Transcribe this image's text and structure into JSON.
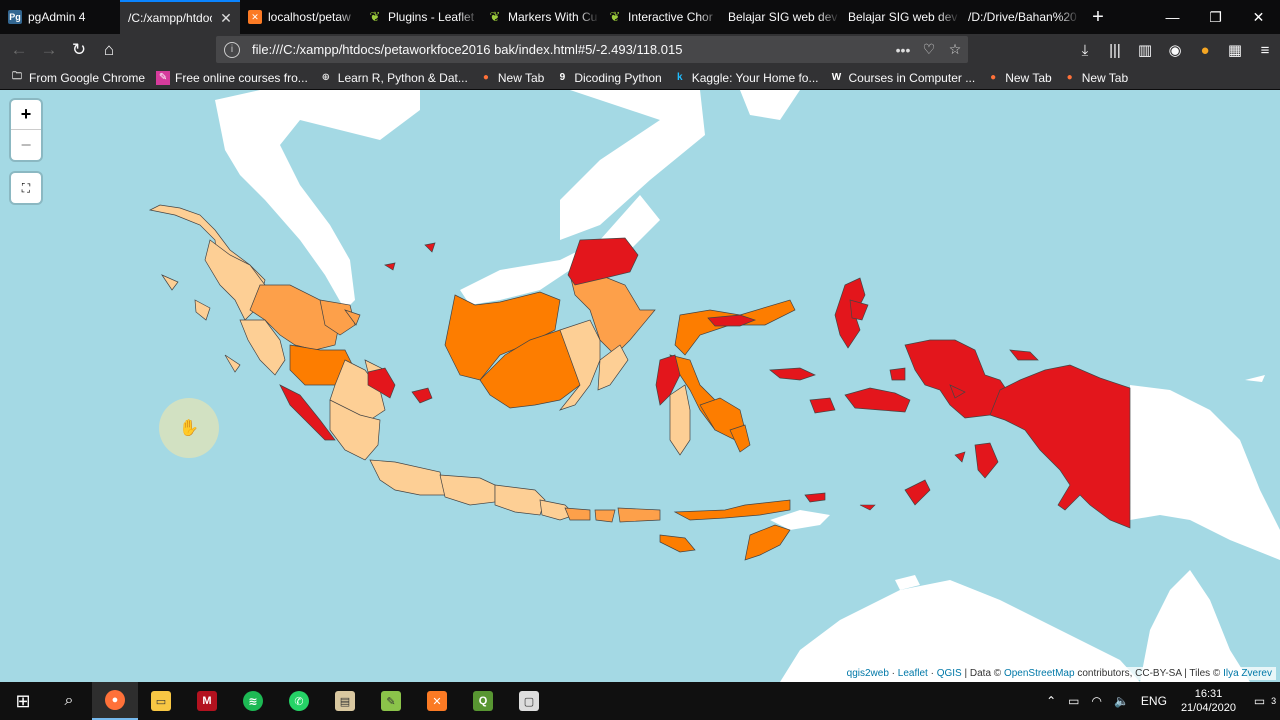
{
  "browser": {
    "tabs": [
      {
        "title": "pgAdmin 4",
        "favicon": "pgadmin-icon",
        "active": false
      },
      {
        "title": "/C:/xampp/htdoc",
        "favicon": "",
        "active": true
      },
      {
        "title": "localhost/petaw",
        "favicon": "xampp-icon",
        "active": false
      },
      {
        "title": "Plugins - Leaflet",
        "favicon": "leaflet-icon",
        "active": false
      },
      {
        "title": "Markers With Cu",
        "favicon": "leaflet-icon",
        "active": false
      },
      {
        "title": "Interactive Chor",
        "favicon": "leaflet-icon",
        "active": false
      },
      {
        "title": "Belajar SIG web dev",
        "favicon": "",
        "active": false
      },
      {
        "title": "Belajar SIG web dev",
        "favicon": "",
        "active": false
      },
      {
        "title": "/D:/Drive/Bahan%20",
        "favicon": "",
        "active": false
      }
    ],
    "url": "file:///C:/xampp/htdocs/petaworkfoce2016 bak/index.html#5/-2.493/118.015",
    "bookmarks": [
      {
        "label": "From Google Chrome",
        "icon": "folder-icon"
      },
      {
        "label": "Free online courses fro...",
        "icon": "courses-icon"
      },
      {
        "label": "Learn R, Python & Dat...",
        "icon": "globe-icon"
      },
      {
        "label": "New Tab",
        "icon": "firefox-icon"
      },
      {
        "label": "Dicoding Python",
        "icon": "dicoding-icon"
      },
      {
        "label": "Kaggle: Your Home fo...",
        "icon": "kaggle-icon"
      },
      {
        "label": "Courses in Computer ...",
        "icon": "w-icon"
      },
      {
        "label": "New Tab",
        "icon": "firefox-icon"
      },
      {
        "label": "New Tab",
        "icon": "firefox-icon"
      }
    ]
  },
  "map": {
    "zoom_in": "+",
    "zoom_out": "−",
    "attribution": {
      "qgis2web": "qgis2web",
      "sep1": " · ",
      "leaflet": "Leaflet",
      "sep2": " · ",
      "qgis": "QGIS",
      "rest": " | Data © ",
      "osm": "OpenStreetMap",
      "rest2": " contributors, CC-BY-SA | Tiles © ",
      "author": "Ilya Zverev"
    },
    "colors": {
      "water": "#a4d9e4",
      "land": "#ffffff",
      "class_low": "#fdcf95",
      "class_mid_low": "#fda04a",
      "class_mid_high": "#fd7d00",
      "class_high": "#e3161c"
    }
  },
  "taskbar": {
    "time": "16:31",
    "date": "21/04/2020",
    "lang": "ENG",
    "notifications": "3"
  }
}
